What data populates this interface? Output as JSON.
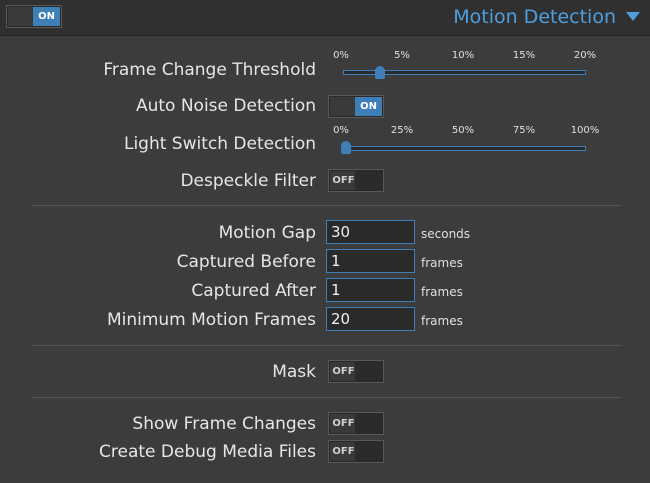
{
  "header": {
    "enabled_label": "ON",
    "title": "Motion Detection",
    "caret_icon": "chevron-down-icon",
    "accent": "#3e7fb8"
  },
  "fields": {
    "frame_change_threshold": {
      "label": "Frame Change Threshold",
      "value_percent": 3,
      "min": 0,
      "max": 20,
      "ticks": [
        "0%",
        "5%",
        "10%",
        "15%",
        "20%"
      ]
    },
    "auto_noise_detection": {
      "label": "Auto Noise Detection",
      "state": "ON"
    },
    "light_switch_detection": {
      "label": "Light Switch Detection",
      "value_percent": 0,
      "min": 0,
      "max": 100,
      "ticks": [
        "0%",
        "25%",
        "50%",
        "75%",
        "100%"
      ]
    },
    "despeckle_filter": {
      "label": "Despeckle Filter",
      "state": "OFF"
    },
    "motion_gap": {
      "label": "Motion Gap",
      "value": "30",
      "unit": "seconds"
    },
    "captured_before": {
      "label": "Captured Before",
      "value": "1",
      "unit": "frames"
    },
    "captured_after": {
      "label": "Captured After",
      "value": "1",
      "unit": "frames"
    },
    "minimum_motion_frames": {
      "label": "Minimum Motion Frames",
      "value": "20",
      "unit": "frames"
    },
    "mask": {
      "label": "Mask",
      "state": "OFF"
    },
    "show_frame_changes": {
      "label": "Show Frame Changes",
      "state": "OFF"
    },
    "create_debug_media_files": {
      "label": "Create Debug Media Files",
      "state": "OFF"
    }
  }
}
